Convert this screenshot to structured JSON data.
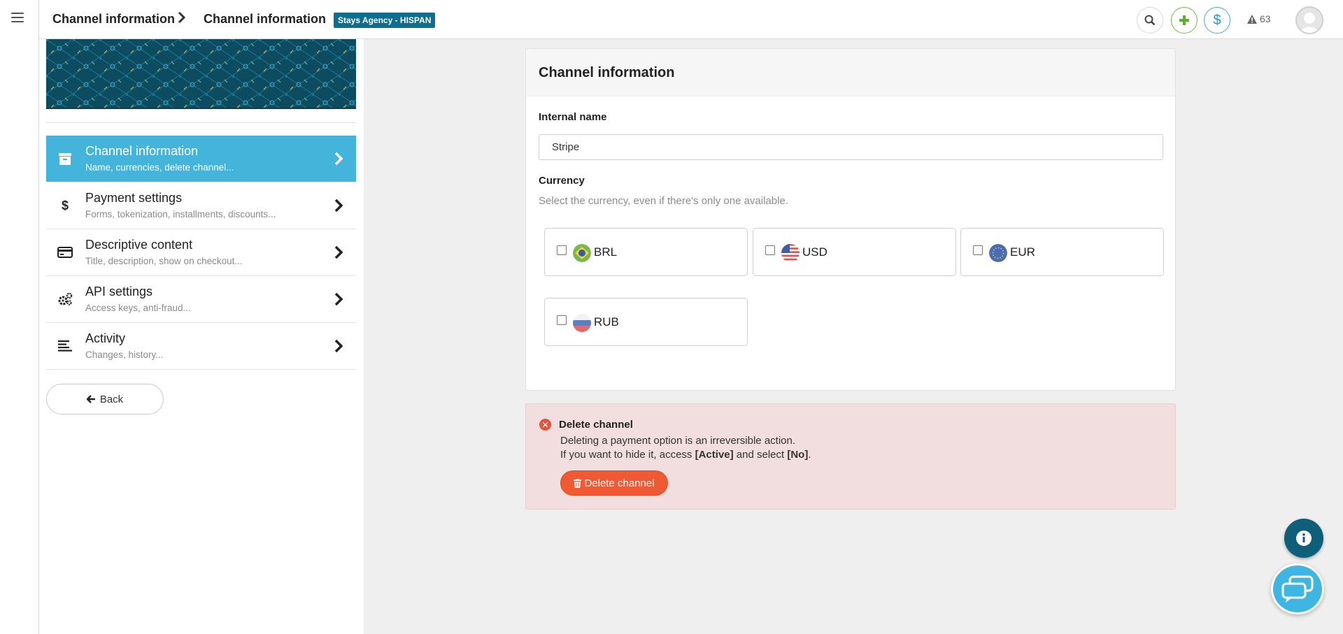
{
  "header": {
    "menu_icon": "hamburger-icon",
    "breadcrumb": [
      "Channel information",
      "Channel information"
    ],
    "agency_badge": "Stays Agency - HISPAN",
    "alerts_count": "63",
    "icons": [
      "search-icon",
      "plus-icon",
      "dollar-icon",
      "warning-icon",
      "user-avatar"
    ],
    "accent_colors": {
      "plus": "#5cb22b",
      "dollar": "#2d95c8",
      "badge": "#0e6e8e"
    }
  },
  "sidebar": {
    "items": [
      {
        "title": "Channel information",
        "subtitle": "Name, currencies, delete channel...",
        "icon": "archive-icon",
        "active": true
      },
      {
        "title": "Payment settings",
        "subtitle": "Forms, tokenization, installments, discounts...",
        "icon": "dollar-icon",
        "active": false
      },
      {
        "title": "Descriptive content",
        "subtitle": "Title, description, show on checkout...",
        "icon": "credit-card-icon",
        "active": false
      },
      {
        "title": "API settings",
        "subtitle": "Access keys, anti-fraud...",
        "icon": "cogs-icon",
        "active": false
      },
      {
        "title": "Activity",
        "subtitle": "Changes, history...",
        "icon": "align-left-icon",
        "active": false
      }
    ],
    "back_label": "Back",
    "active_color": "#44b4db"
  },
  "main": {
    "card_title": "Channel information",
    "internal_name_label": "Internal name",
    "internal_name_value": "Stripe",
    "currency_label": "Currency",
    "currency_hint": "Select the currency, even if there's only one available.",
    "currencies": [
      {
        "code": "BRL",
        "checked": false,
        "flag": "brazil-flag-icon"
      },
      {
        "code": "USD",
        "checked": false,
        "flag": "usa-flag-icon"
      },
      {
        "code": "EUR",
        "checked": false,
        "flag": "eu-flag-icon"
      },
      {
        "code": "RUB",
        "checked": false,
        "flag": "russia-flag-icon"
      }
    ]
  },
  "delete": {
    "title": "Delete channel",
    "line1": "Deleting a payment option is an irreversible action.",
    "line2_prefix": "If you want to hide it, access ",
    "line2_active": "[Active]",
    "line2_mid": " and select ",
    "line2_no": "[No]",
    "line2_suffix": ".",
    "button_label": "Delete channel",
    "button_color": "#ef5a35",
    "background": "#f2dede"
  },
  "floating": {
    "info_icon": "info-icon",
    "chat_icon": "chat-icon"
  }
}
